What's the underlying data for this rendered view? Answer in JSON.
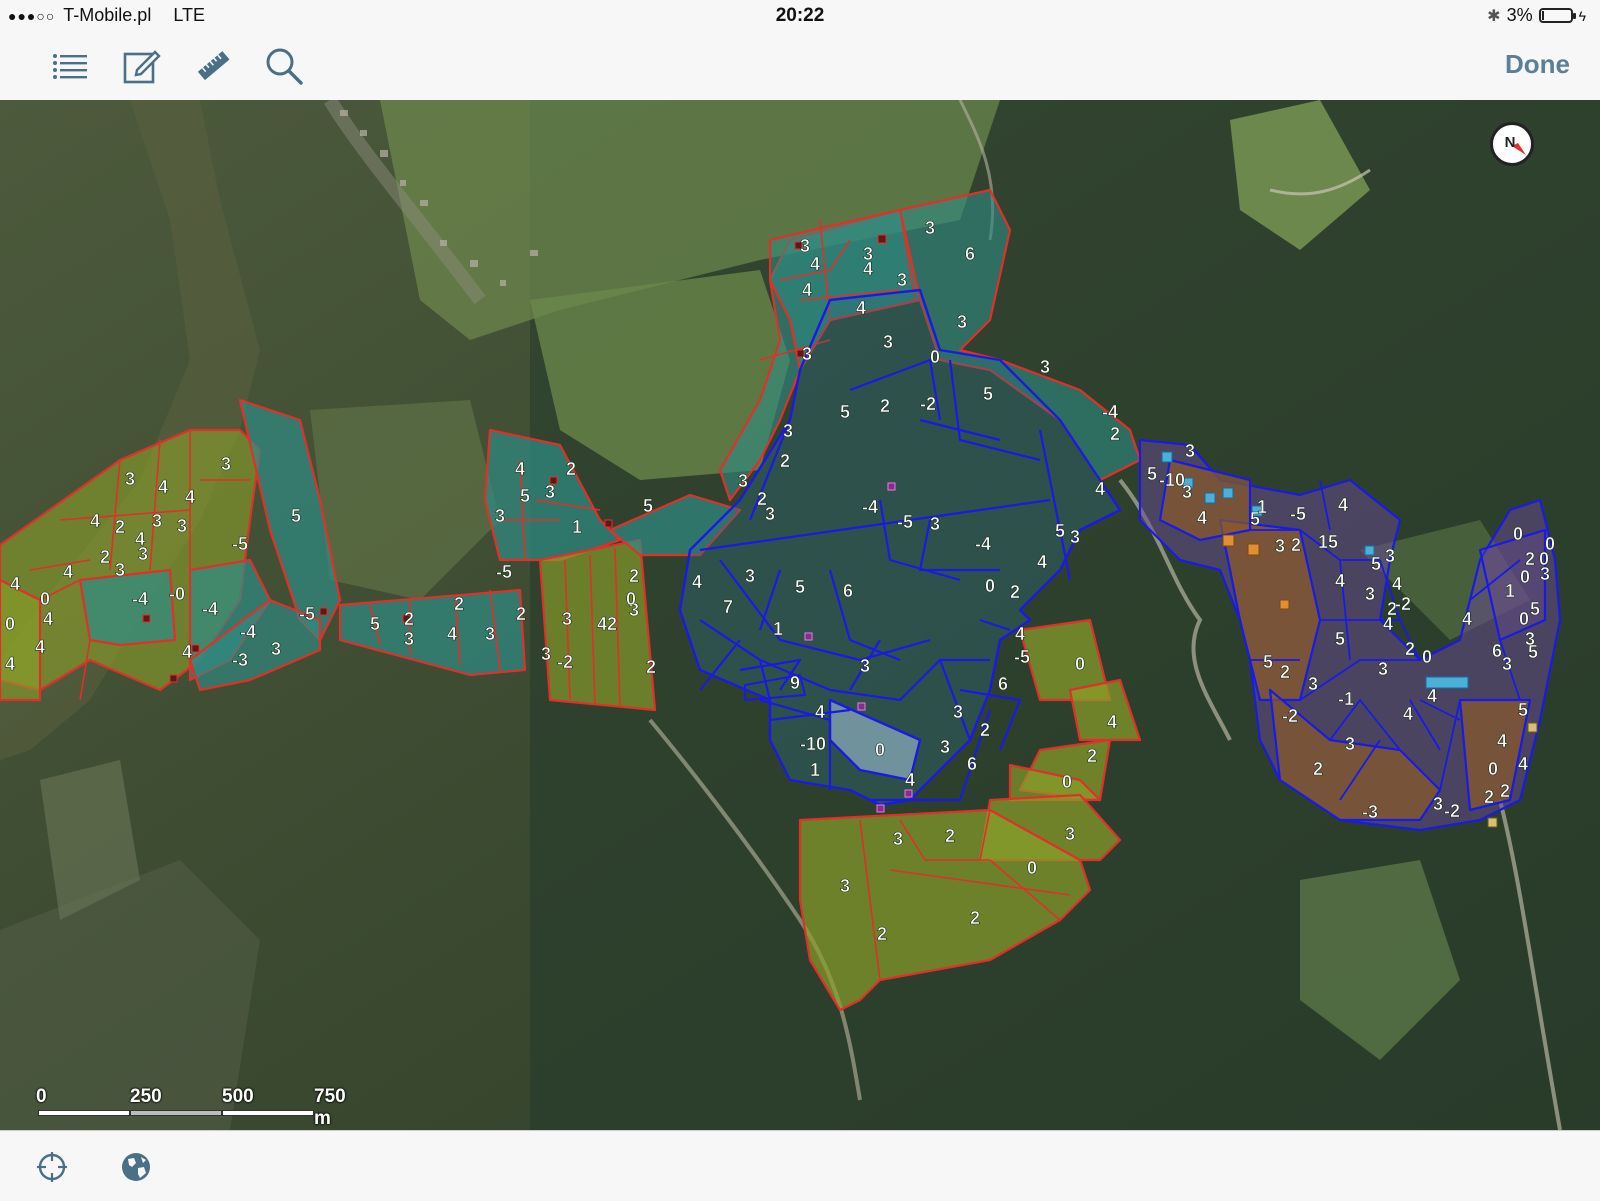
{
  "status_bar": {
    "carrier": "T-Mobile.pl",
    "network": "LTE",
    "time": "20:22",
    "battery": "3%",
    "battery_level": 0.03
  },
  "toolbar": {
    "list_icon": "list-icon",
    "edit_icon": "edit-icon",
    "measure_icon": "ruler-icon",
    "search_icon": "search-icon",
    "done_label": "Done"
  },
  "map": {
    "compass_label": "N",
    "scale_labels": [
      "0",
      "250",
      "500",
      "750 m"
    ],
    "colors": {
      "red_outline": "#e0302a",
      "blue_outline": "#1a1ae6",
      "teal_fill": "#2f8c84",
      "olive_fill": "#8ca02a",
      "purple_fill": "#6a4a96",
      "brown_fill": "#8a5a2a"
    },
    "parcel_labels": [
      "3",
      "4",
      "4",
      "3",
      "4",
      "2",
      "3",
      "3",
      "4",
      "3",
      "2",
      "3",
      "4",
      "-5",
      "-4",
      "-0",
      "-4",
      "4",
      "-4",
      "-3",
      "3",
      "0",
      "4",
      "0",
      "4",
      "4",
      "4",
      "5",
      "-5",
      "4",
      "2",
      "5",
      "3",
      "3",
      "1",
      "-5",
      "2",
      "3",
      "0",
      "5",
      "2",
      "3",
      "4",
      "2",
      "3",
      "2",
      "3",
      "42",
      "-2",
      "2",
      "3",
      "5",
      "3",
      "3",
      "6",
      "4",
      "3",
      "4",
      "3",
      "4",
      "4",
      "3",
      "3",
      "3",
      "0",
      "-2",
      "2",
      "5",
      "3",
      "5",
      "3",
      "2",
      "-4",
      "2",
      "3",
      "3",
      "2",
      "-4",
      "-4",
      "-5",
      "3",
      "4",
      "5",
      "3",
      "4",
      "4",
      "3",
      "7",
      "5",
      "6",
      "1",
      "3",
      "9",
      "4",
      "-10",
      "1",
      "0",
      "4",
      "0",
      "2",
      "4",
      "-5",
      "6",
      "3",
      "2",
      "3",
      "6",
      "0",
      "4",
      "2",
      "0",
      "3",
      "0",
      "3",
      "2",
      "3",
      "2",
      "2",
      "3",
      "5",
      "-10",
      "3",
      "4",
      "1",
      "5",
      "-5",
      "2",
      "3",
      "15",
      "4",
      "3",
      "5",
      "4",
      "3",
      "4",
      "2",
      "0",
      "2",
      "3",
      "5",
      "3",
      "2",
      "5",
      "-2",
      "-1",
      "3",
      "4",
      "4",
      "4",
      "-2",
      "0",
      "0",
      "2",
      "0",
      "0",
      "1",
      "3",
      "5",
      "3",
      "6",
      "5",
      "0",
      "4",
      "3",
      "5",
      "4",
      "0",
      "4",
      "2",
      "3",
      "-2",
      "2",
      "-3",
      "2",
      "4",
      "5",
      "5",
      "3",
      "0",
      "2",
      "1",
      "3",
      "4",
      "-3"
    ]
  }
}
